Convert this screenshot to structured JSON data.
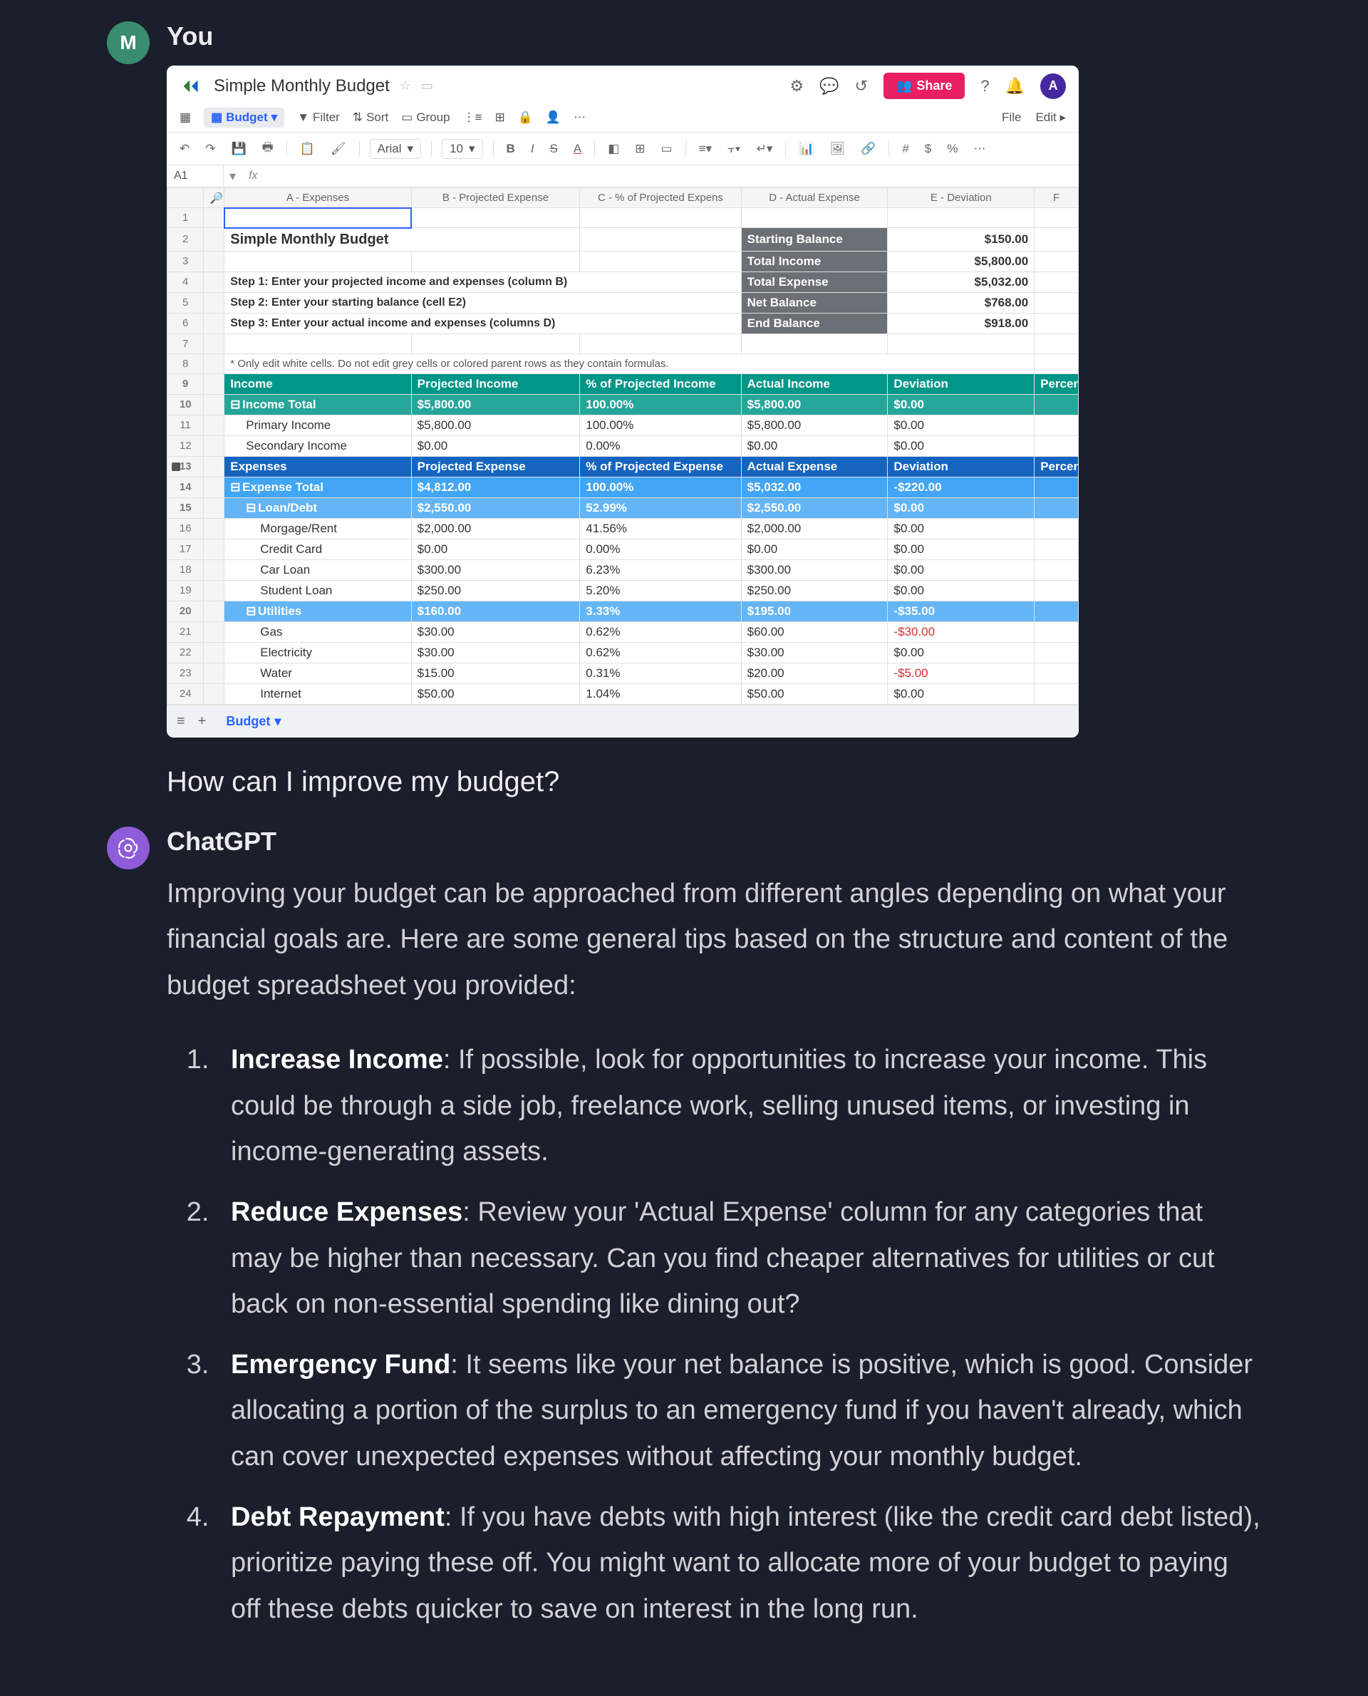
{
  "user": {
    "avatar_letter": "M",
    "sender": "You",
    "question": "How can I improve my budget?"
  },
  "bot": {
    "sender": "ChatGPT",
    "intro": "Improving your budget can be approached from different angles depending on what your financial goals are. Here are some general tips based on the structure and content of the budget spreadsheet you provided:",
    "tips": [
      {
        "title": "Increase Income",
        "body": ": If possible, look for opportunities to increase your income. This could be through a side job, freelance work, selling unused items, or investing in income-generating assets."
      },
      {
        "title": "Reduce Expenses",
        "body": ": Review your 'Actual Expense' column for any categories that may be higher than necessary. Can you find cheaper alternatives for utilities or cut back on non-essential spending like dining out?"
      },
      {
        "title": "Emergency Fund",
        "body": ": It seems like your net balance is positive, which is good. Consider allocating a portion of the surplus to an emergency fund if you haven't already, which can cover unexpected expenses without affecting your monthly budget."
      },
      {
        "title": "Debt Repayment",
        "body": ": If you have debts with high interest (like the credit card debt listed), prioritize paying these off. You might want to allocate more of your budget to paying off these debts quicker to save on interest in the long run."
      }
    ]
  },
  "spreadsheet": {
    "doc_title": "Simple Monthly Budget",
    "share": "Share",
    "profile": "A",
    "toolbar1": {
      "budget": "Budget",
      "filter": "Filter",
      "sort": "Sort",
      "group": "Group",
      "file": "File",
      "edit": "Edit"
    },
    "toolbar2": {
      "font": "Arial",
      "size": "10"
    },
    "cell_ref": "A1",
    "fx": "fx",
    "col_headers": {
      "A": "A - Expenses",
      "B": "B - Projected Expense",
      "C": "C - % of Projected Expens",
      "D": "D - Actual Expense",
      "E": "E - Deviation",
      "F": "F"
    },
    "title_row": "Simple Monthly Budget",
    "steps": {
      "s1": "Step 1: Enter your projected income and expenses (column B)",
      "s2": "Step 2: Enter your starting balance (cell E2)",
      "s3": "Step 3: Enter your actual income and expenses (columns D)"
    },
    "note": "* Only edit white cells. Do not edit grey cells or colored parent rows as they contain formulas.",
    "summary": {
      "starting": {
        "label": "Starting Balance",
        "val": "$150.00"
      },
      "income": {
        "label": "Total Income",
        "val": "$5,800.00"
      },
      "expense": {
        "label": "Total Expense",
        "val": "$5,032.00"
      },
      "net": {
        "label": "Net Balance",
        "val": "$768.00"
      },
      "end": {
        "label": "End Balance",
        "val": "$918.00"
      }
    },
    "income_header": {
      "a": "Income",
      "b": "Projected Income",
      "c": "% of Projected Income",
      "d": "Actual Income",
      "e": "Deviation",
      "f": "Percen"
    },
    "income_total": {
      "a": "Income Total",
      "b": "$5,800.00",
      "c": "100.00%",
      "d": "$5,800.00",
      "e": "$0.00"
    },
    "income_rows": [
      {
        "a": "Primary Income",
        "b": "$5,800.00",
        "c": "100.00%",
        "d": "$5,800.00",
        "e": "$0.00"
      },
      {
        "a": "Secondary Income",
        "b": "$0.00",
        "c": "0.00%",
        "d": "$0.00",
        "e": "$0.00"
      }
    ],
    "expense_header": {
      "a": "Expenses",
      "b": "Projected Expense",
      "c": "% of Projected Expense",
      "d": "Actual Expense",
      "e": "Deviation",
      "f": "Percen"
    },
    "expense_total": {
      "a": "Expense Total",
      "b": "$4,812.00",
      "c": "100.00%",
      "d": "$5,032.00",
      "e": "-$220.00"
    },
    "loan_row": {
      "a": "Loan/Debt",
      "b": "$2,550.00",
      "c": "52.99%",
      "d": "$2,550.00",
      "e": "$0.00"
    },
    "loan_children": [
      {
        "a": "Morgage/Rent",
        "b": "$2,000.00",
        "c": "41.56%",
        "d": "$2,000.00",
        "e": "$0.00"
      },
      {
        "a": "Credit Card",
        "b": "$0.00",
        "c": "0.00%",
        "d": "$0.00",
        "e": "$0.00"
      },
      {
        "a": "Car Loan",
        "b": "$300.00",
        "c": "6.23%",
        "d": "$300.00",
        "e": "$0.00"
      },
      {
        "a": "Student Loan",
        "b": "$250.00",
        "c": "5.20%",
        "d": "$250.00",
        "e": "$0.00"
      }
    ],
    "util_row": {
      "a": "Utilities",
      "b": "$160.00",
      "c": "3.33%",
      "d": "$195.00",
      "e": "-$35.00"
    },
    "util_children": [
      {
        "a": "Gas",
        "b": "$30.00",
        "c": "0.62%",
        "d": "$60.00",
        "e": "-$30.00",
        "neg": true
      },
      {
        "a": "Electricity",
        "b": "$30.00",
        "c": "0.62%",
        "d": "$30.00",
        "e": "$0.00"
      },
      {
        "a": "Water",
        "b": "$15.00",
        "c": "0.31%",
        "d": "$20.00",
        "e": "-$5.00",
        "neg": true
      },
      {
        "a": "Internet",
        "b": "$50.00",
        "c": "1.04%",
        "d": "$50.00",
        "e": "$0.00"
      }
    ],
    "sheet_tab": "Budget"
  }
}
